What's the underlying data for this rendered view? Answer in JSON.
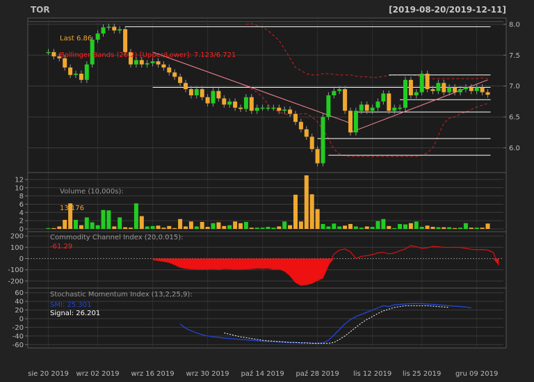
{
  "chart_data": [
    {
      "type": "candlestick",
      "title": "TOR",
      "date_range": "[2019-08-20/2019-12-11]",
      "last_label": "Last 6.86",
      "bbands_label": "Bollinger Bands (20,2) [Upper/Lower]: 7.123/6.721",
      "ylim": [
        5.6,
        8.1
      ],
      "yticks": [
        "8.0",
        "7.5",
        "7.0",
        "6.5",
        "6.0"
      ],
      "ytick_values": [
        8.0,
        7.5,
        7.0,
        6.5,
        6.0
      ],
      "x_tick_labels": [
        "sie 20 2019",
        "wrz 02 2019",
        "wrz 16 2019",
        "wrz 30 2019",
        "paź 14 2019",
        "paź 28 2019",
        "lis 12 2019",
        "lis 25 2019",
        "gru 09 2019"
      ],
      "x_tick_index": [
        0,
        9,
        19,
        29,
        39,
        49,
        59,
        68,
        78
      ],
      "n_bars": 81,
      "close": [
        7.55,
        7.48,
        7.45,
        7.3,
        7.18,
        7.2,
        7.1,
        7.35,
        7.75,
        7.85,
        7.95,
        7.96,
        7.9,
        7.92,
        7.55,
        7.35,
        7.42,
        7.35,
        7.37,
        7.4,
        7.35,
        7.3,
        7.22,
        7.15,
        7.05,
        6.95,
        6.85,
        6.95,
        6.82,
        6.72,
        6.92,
        6.8,
        6.7,
        6.75,
        6.65,
        6.63,
        6.82,
        6.6,
        6.65,
        6.65,
        6.65,
        6.65,
        6.6,
        6.62,
        6.55,
        6.42,
        6.3,
        6.18,
        5.98,
        5.75,
        6.5,
        6.85,
        6.92,
        6.95,
        6.6,
        6.25,
        6.6,
        6.7,
        6.6,
        6.65,
        6.75,
        6.88,
        6.6,
        6.65,
        6.65,
        7.1,
        6.85,
        6.9,
        7.2,
        6.95,
        6.92,
        7.05,
        6.9,
        6.98,
        6.9,
        6.95,
        6.98,
        6.92,
        6.98,
        6.9,
        6.86
      ],
      "bollinger_upper": [
        8.0,
        8.01,
        7.98,
        7.95,
        7.9,
        7.82,
        7.74,
        7.6,
        7.45,
        7.3,
        7.25,
        7.2,
        7.18,
        7.18,
        7.2,
        7.2,
        7.19,
        7.18,
        7.18,
        7.18,
        7.16,
        7.15,
        7.15,
        7.14,
        7.14,
        7.16,
        7.17,
        7.18,
        7.18,
        7.18,
        7.18,
        7.17,
        7.15,
        7.13,
        7.12,
        7.12,
        7.12,
        7.12,
        7.12,
        7.12,
        7.12,
        7.12,
        7.12,
        7.13,
        7.12
      ],
      "bollinger_lower": [
        7.0,
        6.95,
        6.9,
        6.82,
        6.7,
        6.63,
        6.58,
        6.55,
        6.53,
        6.53,
        6.55,
        6.55,
        6.5,
        6.42,
        6.3,
        6.15,
        5.98,
        5.9,
        5.87,
        5.86,
        5.86,
        5.86,
        5.86,
        5.86,
        5.86,
        5.86,
        5.86,
        5.86,
        5.86,
        5.86,
        5.86,
        5.86,
        5.88,
        5.92,
        6.0,
        6.2,
        6.4,
        6.48,
        6.5,
        6.55,
        6.58,
        6.62,
        6.66,
        6.69,
        6.72
      ]
    },
    {
      "type": "bar",
      "title": "Volume (10,000s):",
      "last_value": "13,176",
      "ylim": [
        0,
        13
      ],
      "yticks": [
        "12",
        "10",
        "8",
        "6",
        "4",
        "2",
        "0"
      ],
      "ytick_values": [
        12,
        10,
        8,
        6,
        4,
        2,
        0
      ],
      "values": [
        0.2,
        0.2,
        0.6,
        2.2,
        6.2,
        2.2,
        0.9,
        2.8,
        1.6,
        0.9,
        4.6,
        4.5,
        0.6,
        2.8,
        0.4,
        0.3,
        6.2,
        3.1,
        0.6,
        0.7,
        0.8,
        0.3,
        0.7,
        0.2,
        2.4,
        0.6,
        1.8,
        0.6,
        1.7,
        0.5,
        1.4,
        1.6,
        0.7,
        0.9,
        1.8,
        1.4,
        1.7,
        0.3,
        0.3,
        0.3,
        0.5,
        0.3,
        0.6,
        1.8,
        0.9,
        8.3,
        1.8,
        13.0,
        8.4,
        4.8,
        1.2,
        0.6,
        1.3,
        0.6,
        0.8,
        1.2,
        0.6,
        0.3,
        0.6,
        0.5,
        1.9,
        2.4,
        0.7,
        0.2,
        1.2,
        1.1,
        1.4,
        1.8,
        0.5,
        0.8,
        0.5,
        0.4,
        0.4,
        0.4,
        0.2,
        0.3,
        1.4,
        0.3,
        0.3,
        0.3,
        1.3
      ]
    },
    {
      "type": "line",
      "title": "Commodity Channel Index (20,0.015):",
      "last_value": "-61.29",
      "ylim": [
        -250,
        220
      ],
      "yticks": [
        "200",
        "100",
        "0",
        "-100",
        "-200"
      ],
      "ytick_values": [
        200,
        100,
        0,
        -100,
        -200
      ],
      "start_index": 19,
      "values": [
        -10,
        -18,
        -25,
        -35,
        -55,
        -78,
        -88,
        -92,
        -95,
        -96,
        -95,
        -92,
        -98,
        -90,
        -92,
        -96,
        -95,
        -93,
        -90,
        -85,
        -88,
        -85,
        -95,
        -93,
        -112,
        -152,
        -212,
        -238,
        -232,
        -220,
        -195,
        -172,
        -60,
        40,
        75,
        85,
        60,
        0,
        20,
        25,
        35,
        50,
        55,
        42,
        50,
        70,
        85,
        115,
        105,
        90,
        95,
        108,
        105,
        100,
        98,
        100,
        98,
        90,
        82,
        78,
        80,
        75,
        55,
        -61
      ]
    },
    {
      "type": "line",
      "title": "Stochastic Momentum Index (13,2,25,9):",
      "smi_label": "SMI: 25.301",
      "signal_label": "Signal: 26.201",
      "ylim": [
        -66,
        66
      ],
      "yticks": [
        "60",
        "40",
        "20",
        "0",
        "-20",
        "-40",
        "-60"
      ],
      "ytick_values": [
        60,
        40,
        20,
        0,
        -20,
        -40,
        -60
      ],
      "smi_start": 24,
      "smi": [
        -12,
        -22,
        -28,
        -33,
        -37,
        -40,
        -42,
        -43,
        -45,
        -46,
        -47,
        -48,
        -49,
        -50,
        -51,
        -52,
        -53,
        -53,
        -54,
        -54,
        -55,
        -55,
        -56,
        -56,
        -57,
        -57,
        -56,
        -50,
        -38,
        -25,
        -12,
        -2,
        5,
        10,
        15,
        20,
        25,
        30,
        28,
        32,
        33,
        34,
        35,
        35,
        35,
        34,
        33,
        32,
        31,
        30,
        29,
        28,
        27,
        25
      ],
      "signal_start": 32,
      "signal": [
        -33,
        -36,
        -39,
        -42,
        -44,
        -46,
        -48,
        -50,
        -51,
        -52,
        -53,
        -54,
        -55,
        -55,
        -56,
        -56,
        -57,
        -57,
        -57,
        -57,
        -55,
        -48,
        -40,
        -30,
        -20,
        -10,
        -2,
        5,
        12,
        18,
        22,
        26,
        28,
        30,
        30,
        30,
        30,
        30,
        29,
        28,
        27,
        26
      ]
    }
  ]
}
